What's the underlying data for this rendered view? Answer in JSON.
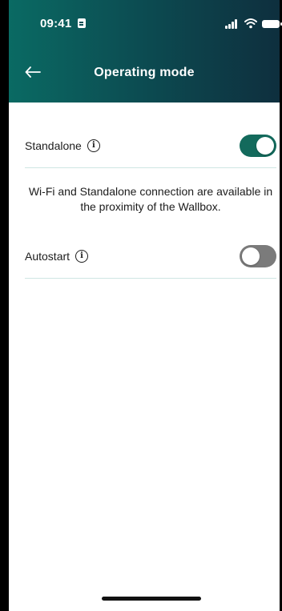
{
  "status_bar": {
    "time": "09:41",
    "icons": [
      "sim-icon",
      "signal-icon",
      "wifi-icon",
      "battery-icon"
    ]
  },
  "header": {
    "title": "Operating mode",
    "back_icon": "back-arrow-icon",
    "gradient_colors": [
      "#0a6a63",
      "#0c4e53",
      "#0e2f3e"
    ]
  },
  "settings": {
    "standalone": {
      "label": "Standalone",
      "enabled": true
    },
    "description": "Wi-Fi and Standalone connection are available in the proximity of the Wallbox.",
    "autostart": {
      "label": "Autostart",
      "enabled": false
    }
  },
  "colors": {
    "toggle_on": "#136a5c",
    "toggle_off": "#7b7b7b",
    "divider": "#cfe6e3"
  }
}
